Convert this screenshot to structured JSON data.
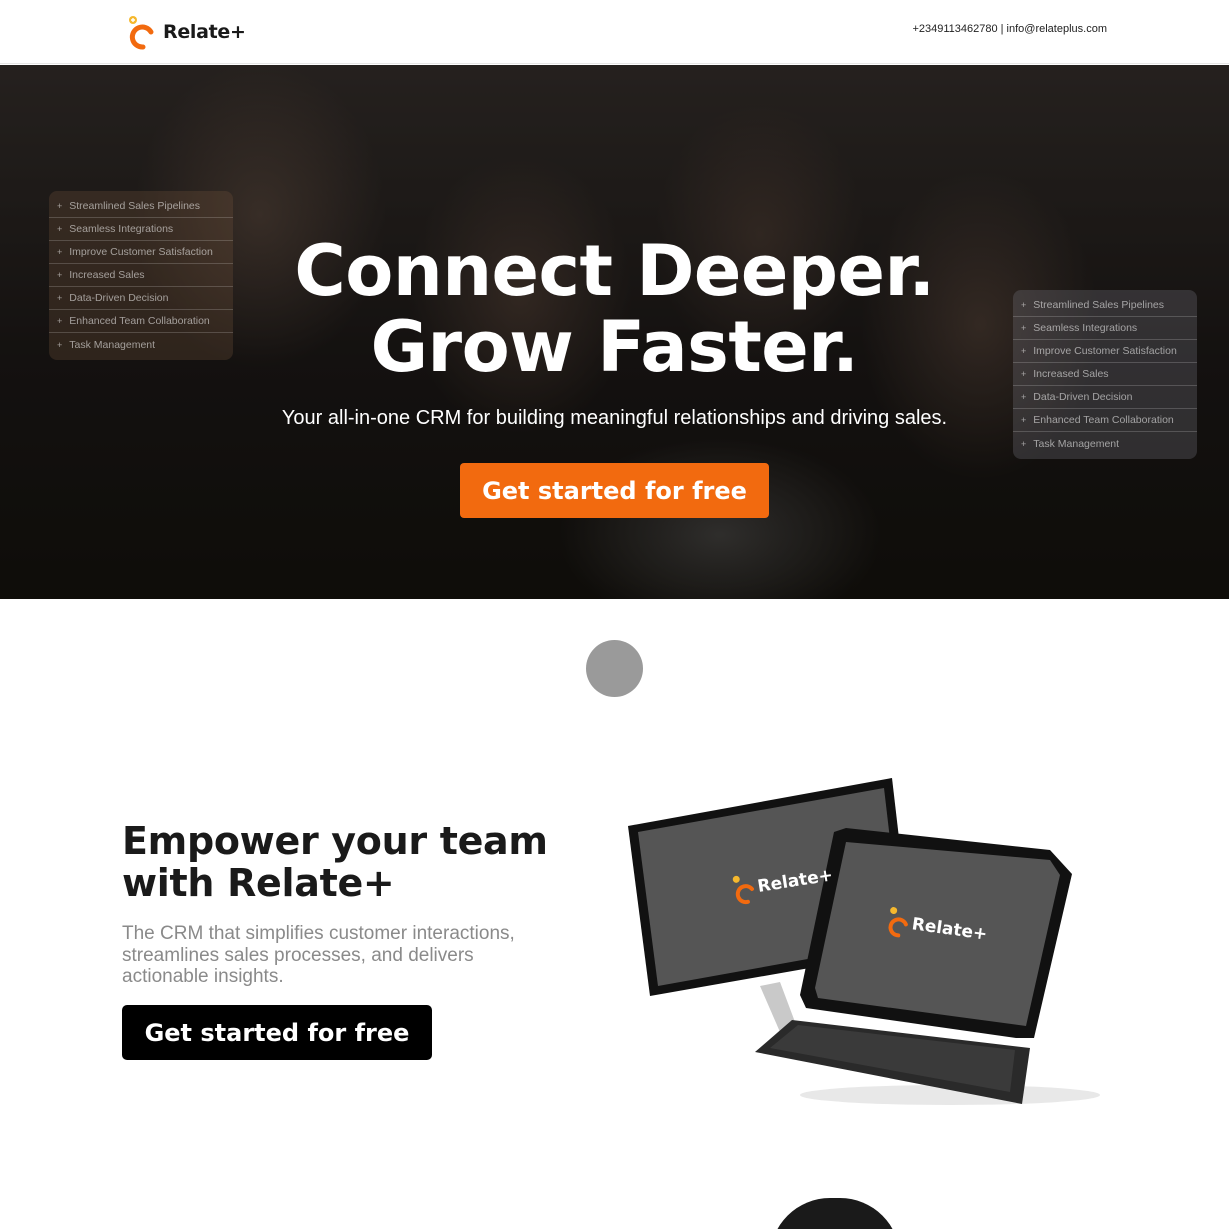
{
  "header": {
    "brand": "Relate+",
    "contact": "+2349113462780 | info@relateplus.com"
  },
  "hero": {
    "title_line1": "Connect Deeper.",
    "title_line2": "Grow Faster.",
    "subtitle": "Your all-in-one CRM for building meaningful relationships and driving sales.",
    "cta": "Get started for free",
    "features": [
      "Streamlined Sales Pipelines",
      "Seamless Integrations",
      "Improve Customer Satisfaction",
      "Increased Sales",
      "Data-Driven Decision",
      "Enhanced Team Collaboration",
      "Task Management"
    ]
  },
  "empower": {
    "title": "Empower your team with Relate+",
    "description": "The CRM that simplifies customer interactions, streamlines sales processes, and delivers actionable insights.",
    "cta": "Get started for free",
    "device_brand_1": "Relate+",
    "device_brand_2": "Relate+"
  },
  "colors": {
    "accent": "#f26a0f",
    "logo_dot": "#f5b82e"
  }
}
